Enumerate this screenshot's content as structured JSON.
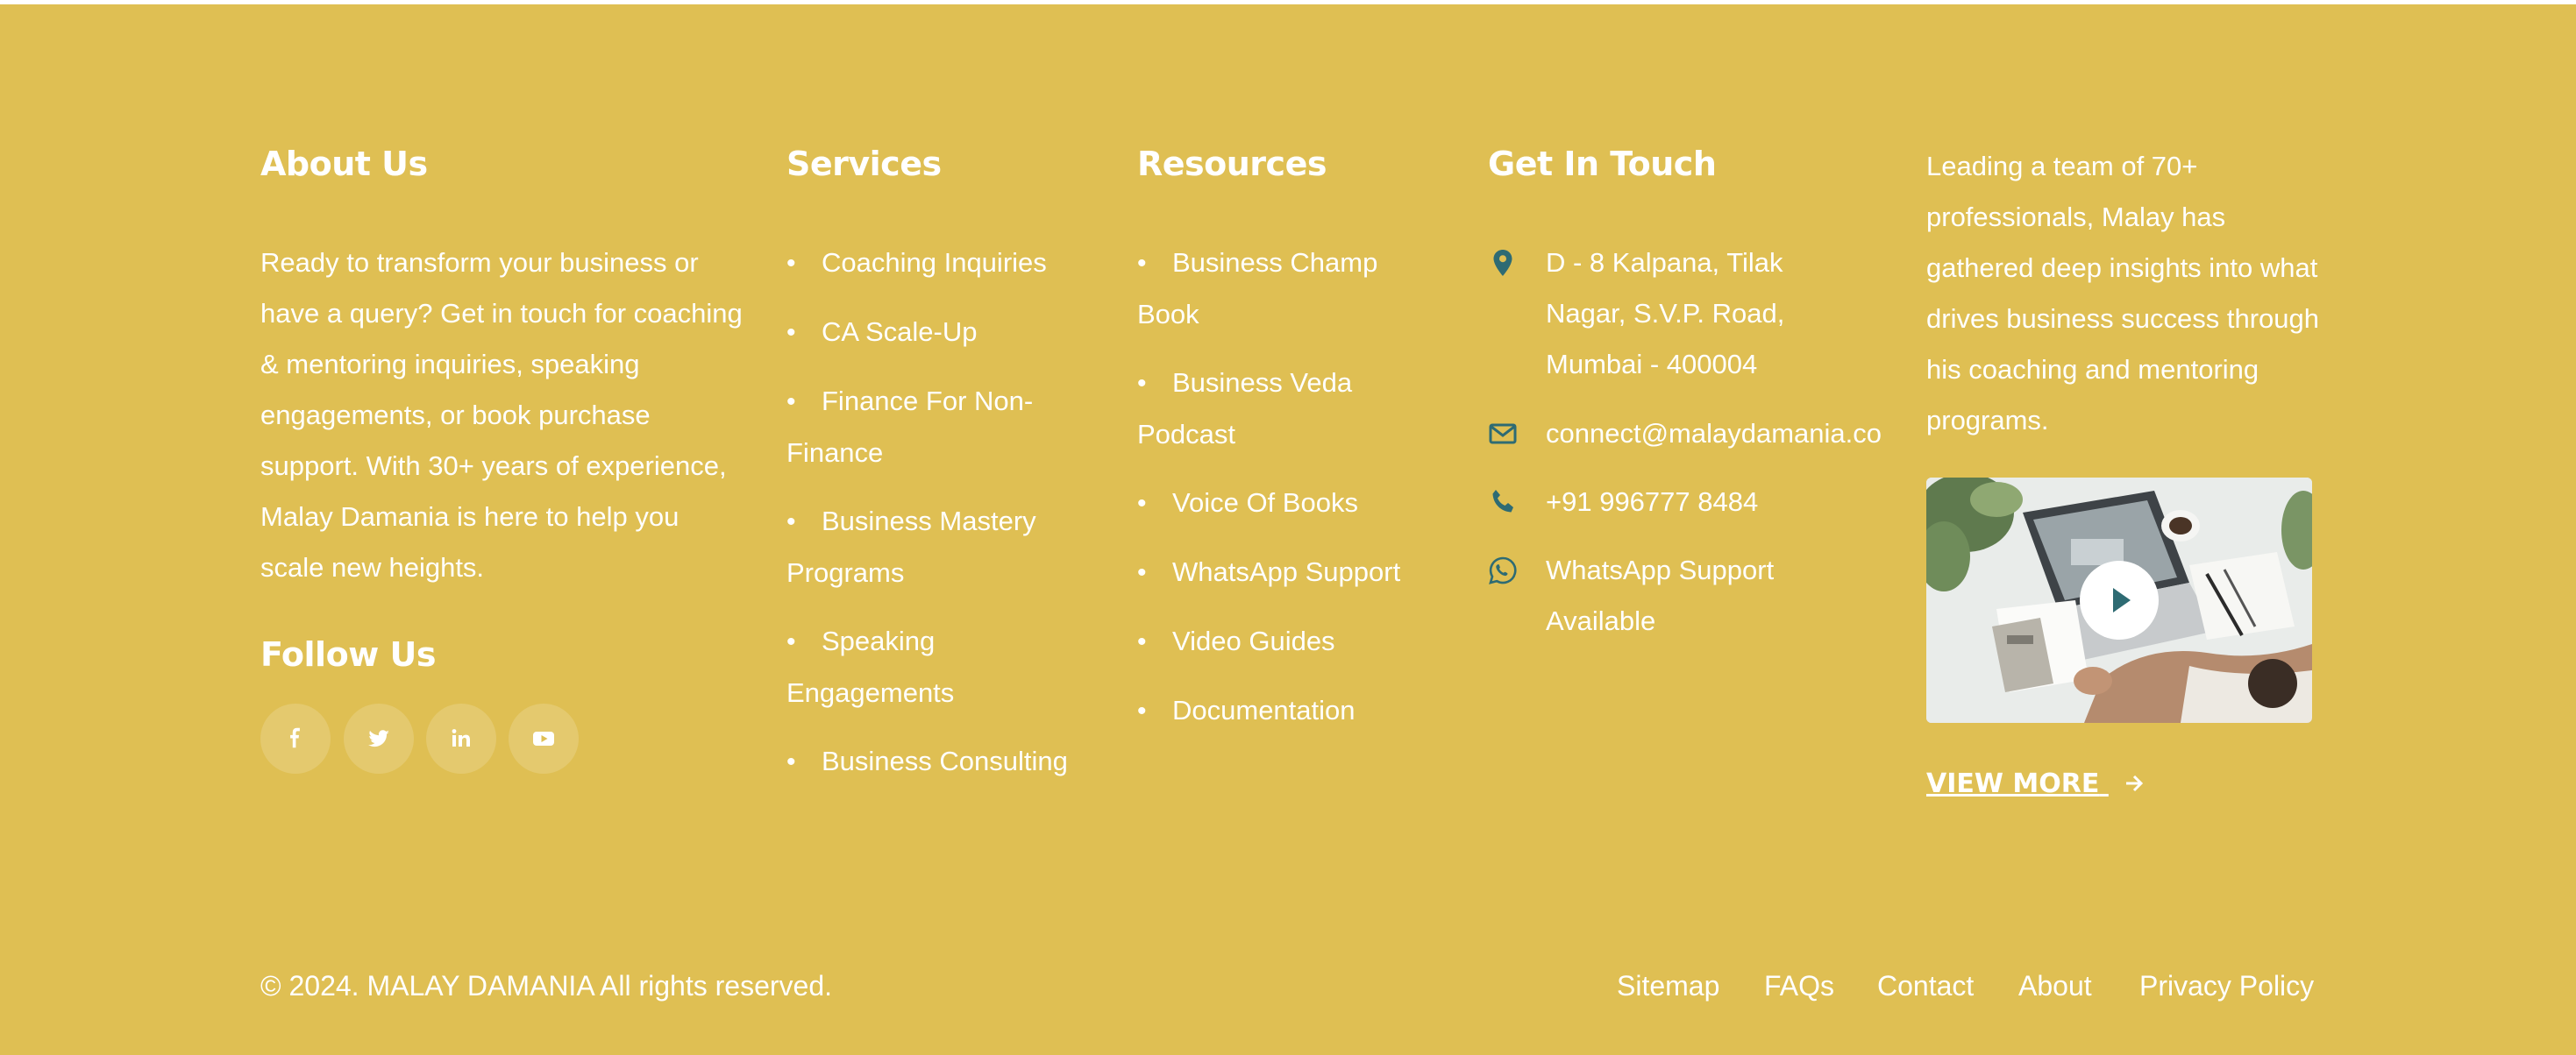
{
  "about": {
    "heading": "About Us",
    "text": "Ready to transform your business or have a query? Get in touch for coaching & mentoring inquiries, speaking engagements, or book purchase support. With 30+ years of experience, Malay Damania is here to help you scale new heights."
  },
  "follow": {
    "heading": "Follow Us",
    "icons": [
      "facebook-icon",
      "twitter-icon",
      "linkedin-icon",
      "youtube-icon"
    ]
  },
  "services": {
    "heading": "Services",
    "items": [
      "Coaching Inquiries",
      "CA Scale-Up",
      "Finance For Non-Finance",
      "Business Mastery Programs",
      "Speaking Engagements",
      "Business Consulting"
    ]
  },
  "resources": {
    "heading": "Resources",
    "items": [
      "Business Champ Book",
      "Business Veda Podcast",
      "Voice Of Books",
      "WhatsApp Support",
      "Video Guides",
      "Documentation"
    ]
  },
  "contact": {
    "heading": "Get In Touch",
    "address": "D - 8 Kalpana, Tilak Nagar, S.V.P. Road, Mumbai - 400004",
    "email": "connect@malaydamania.co",
    "phone": "+91 996777 8484",
    "whatsapp": "WhatsApp Support Available",
    "icons": [
      "location-pin-icon",
      "envelope-icon",
      "phone-icon",
      "whatsapp-icon"
    ]
  },
  "promo": {
    "text": "Leading a team of 70+ professionals, Malay has gathered deep insights into what drives business success through his coaching and mentoring programs.",
    "view_more": "VIEW MORE"
  },
  "bottom": {
    "copyright": "© 2024. MALAY DAMANIA All rights reserved.",
    "links": [
      "Sitemap",
      "FAQs",
      "Contact",
      "About",
      "Privacy Policy"
    ]
  },
  "colors": {
    "background": "#dfbf53",
    "icon_accent": "#2e6b73",
    "text": "#ffffff"
  }
}
